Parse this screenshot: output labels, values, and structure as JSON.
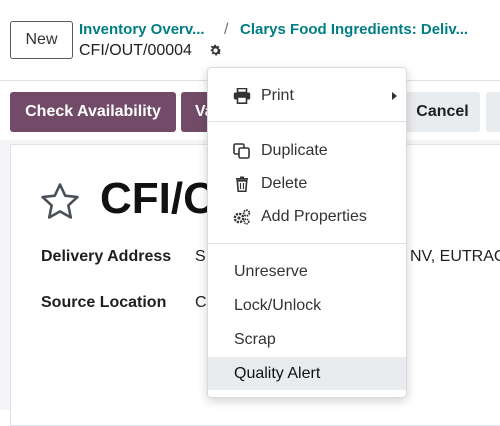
{
  "header": {
    "new_button": "New",
    "breadcrumb": [
      "Inventory Overv...",
      "Clarys Food Ingredients: Deliv..."
    ],
    "separator": "/",
    "record_name": "CFI/OUT/00004"
  },
  "actions": {
    "check_availability": "Check Availability",
    "validate_partial": "Va",
    "cancel": "Cancel"
  },
  "form": {
    "title_partial": "CFI/O",
    "fields": [
      {
        "label": "Delivery Address",
        "value_left": "SI",
        "value_right": "NV, EUTRAC"
      },
      {
        "label": "Source Location",
        "value_left": "C",
        "value_right": ""
      }
    ]
  },
  "menu": {
    "print": "Print",
    "duplicate": "Duplicate",
    "delete": "Delete",
    "add_properties": "Add Properties",
    "unreserve": "Unreserve",
    "lock_unlock": "Lock/Unlock",
    "scrap": "Scrap",
    "quality_alert": "Quality Alert",
    "highlighted_item": "Quality Alert"
  },
  "colors": {
    "primary": "#714b67",
    "link": "#017e84",
    "secondary_button": "#e9ecef"
  },
  "icons": [
    "gear-icon",
    "star-icon",
    "printer-icon",
    "chevron-right-icon",
    "duplicate-icon",
    "trash-icon",
    "gears-icon"
  ]
}
